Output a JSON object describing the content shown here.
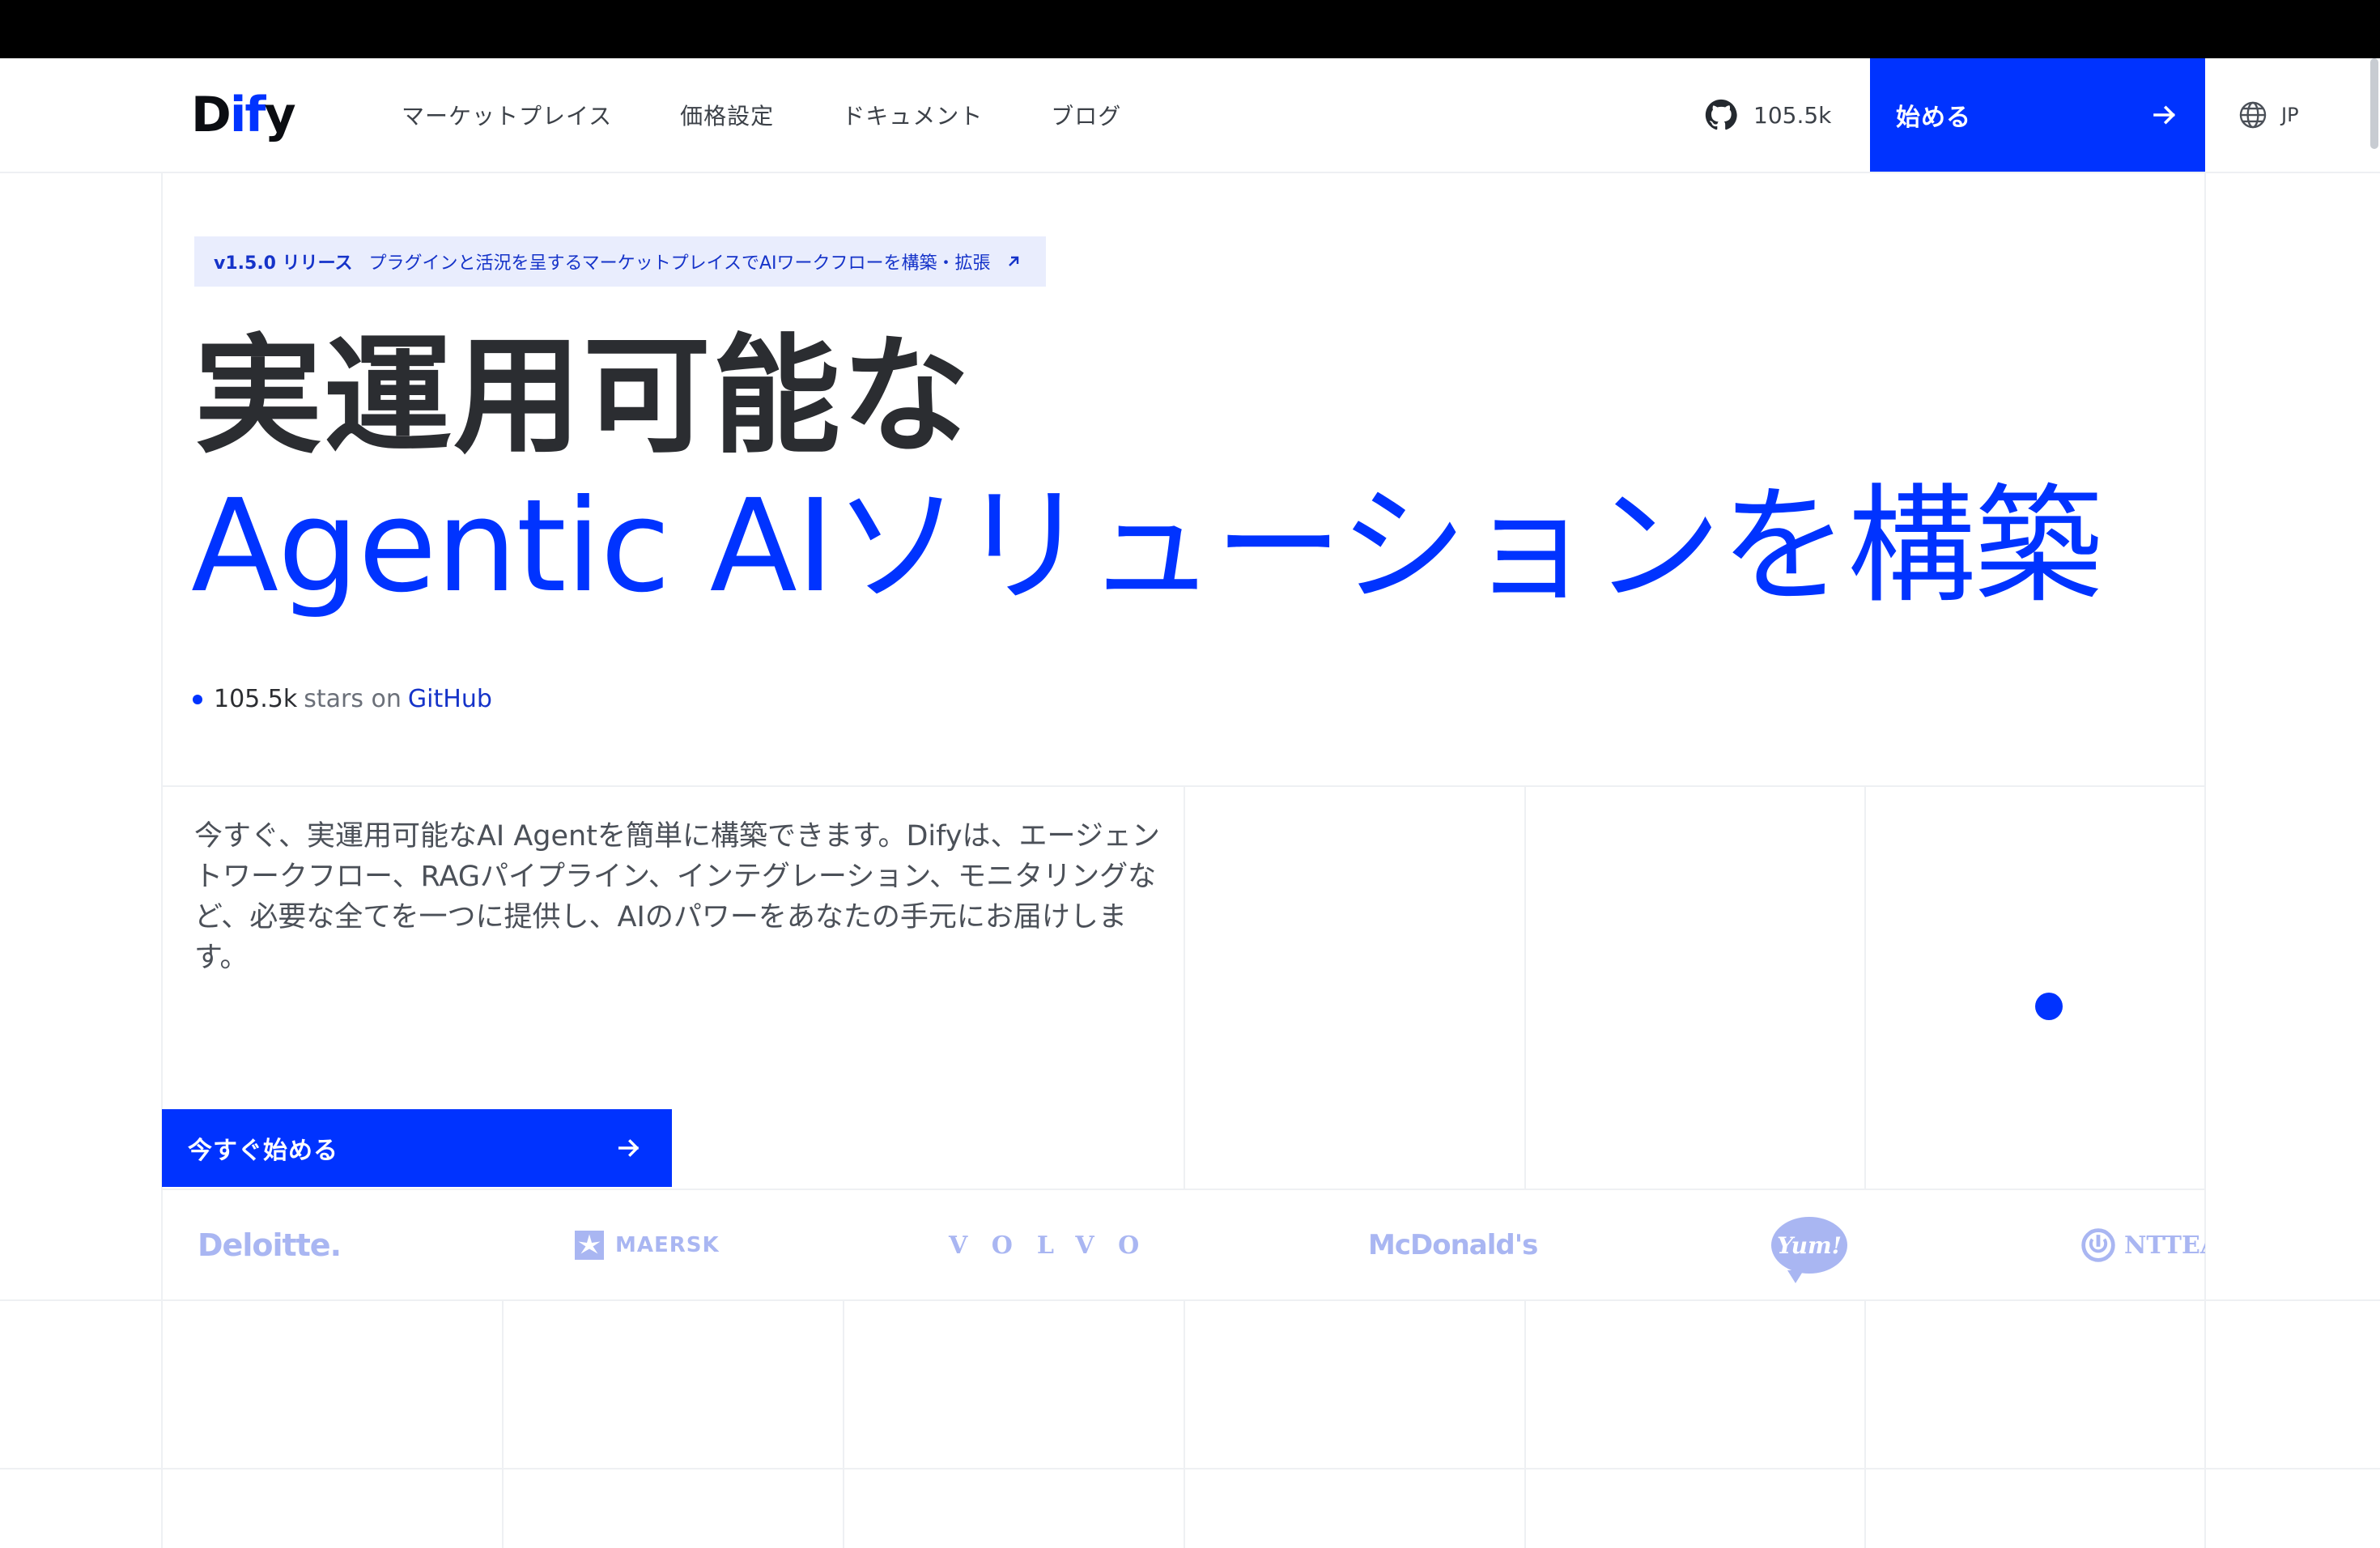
{
  "brand": {
    "name_prefix": "D",
    "name_i": "i",
    "name_f": "f",
    "name_suffix": "y",
    "accent": "#0033ff"
  },
  "nav": [
    {
      "label": "マーケットプレイス"
    },
    {
      "label": "価格設定"
    },
    {
      "label": "ドキュメント"
    },
    {
      "label": "ブログ"
    }
  ],
  "github": {
    "stars": "105.5k",
    "icon": "github-icon"
  },
  "header_cta": {
    "label": "始める",
    "icon": "arrow-right-icon"
  },
  "lang": {
    "label": "JP",
    "icon": "globe-icon"
  },
  "release": {
    "version": "v1.5.0 リリース",
    "text": "プラグインと活況を呈するマーケットプレイスでAIワークフローを構築・拡張",
    "icon": "arrow-up-right-icon"
  },
  "hero": {
    "title_line1": "実運用可能な",
    "title_line2": "Agentic AIソリューションを構築"
  },
  "stars_line": {
    "count": "105.5k",
    "middle": "stars on",
    "link": "GitHub"
  },
  "description": "今すぐ、実運用可能なAI Agentを簡単に構築できます。Difyは、エージェントワークフロー、RAGパイプライン、インテグレーション、モニタリングなど、必要な全てを一つに提供し、AIのパワーをあなたの手元にお届けします。",
  "cta": {
    "label": "今すぐ始める",
    "icon": "arrow-right-icon"
  },
  "customers": [
    {
      "label": "Deloitte."
    },
    {
      "label": "MAERSK"
    },
    {
      "label": "VOLVO"
    },
    {
      "label": "McDonald's"
    },
    {
      "label": "Yum!"
    },
    {
      "label": "NTTEAST"
    }
  ]
}
